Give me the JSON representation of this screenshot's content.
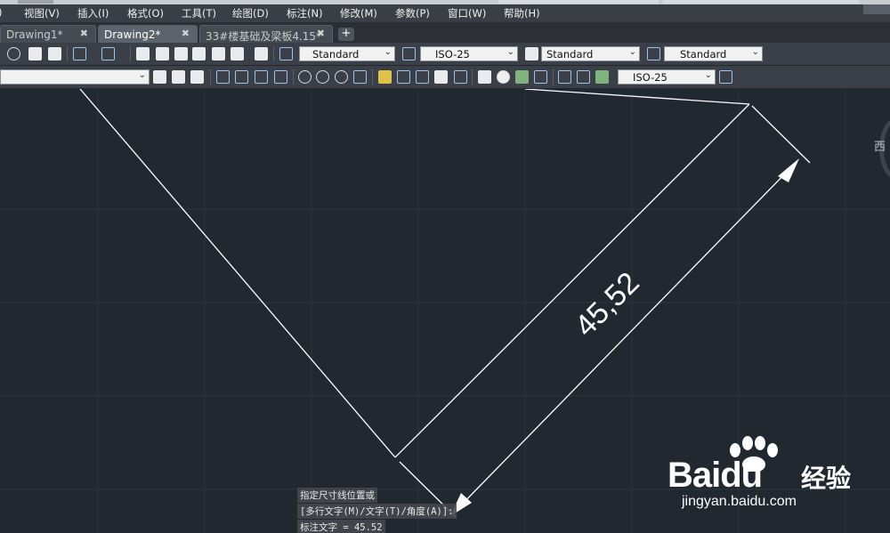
{
  "menu": {
    "items": [
      "视图(V)",
      "插入(I)",
      "格式(O)",
      "工具(T)",
      "绘图(D)",
      "标注(N)",
      "修改(M)",
      "参数(P)",
      "窗口(W)",
      "帮助(H)"
    ]
  },
  "tabs": [
    {
      "label": "Drawing1*",
      "active": false
    },
    {
      "label": "Drawing2*",
      "active": true
    },
    {
      "label": "33#楼基础及梁板4.15*",
      "active": false
    }
  ],
  "tab_close_glyph": "✖",
  "new_tab_glyph": "+",
  "toolbar1": {
    "text_style": "Standard",
    "dim_style": "ISO-25",
    "table_style": "Standard",
    "mleader_style": "Standard"
  },
  "toolbar2": {
    "dim_style": "ISO-25"
  },
  "canvas": {
    "dimension_text": "45,52",
    "viewcube_label": "西"
  },
  "command": {
    "line1": "指定尺寸线位置或",
    "line2": "[多行文字(M)/文字(T)/角度(A)]:",
    "line3": "标注文字 = 45.52"
  },
  "watermark": {
    "logo_bai": "Bai",
    "logo_du": "du",
    "logo_cn": "经验",
    "url": "jingyan.baidu.com"
  },
  "colors": {
    "canvas_bg": "#212830",
    "drawing_lines": "#ffffff",
    "grid": "#2b333d"
  },
  "icons": [
    "undo-icon",
    "redo-icon",
    "help-icon",
    "text-style-icon",
    "dim-style-icon",
    "table-style-icon",
    "mleader-style-icon",
    "linear-dim-icon",
    "aligned-dim-icon",
    "arc-length-icon",
    "ordinate-dim-icon",
    "radius-dim-icon",
    "diameter-dim-icon",
    "angular-dim-icon",
    "baseline-dim-icon",
    "continue-dim-icon",
    "tolerance-icon",
    "center-mark-icon"
  ]
}
